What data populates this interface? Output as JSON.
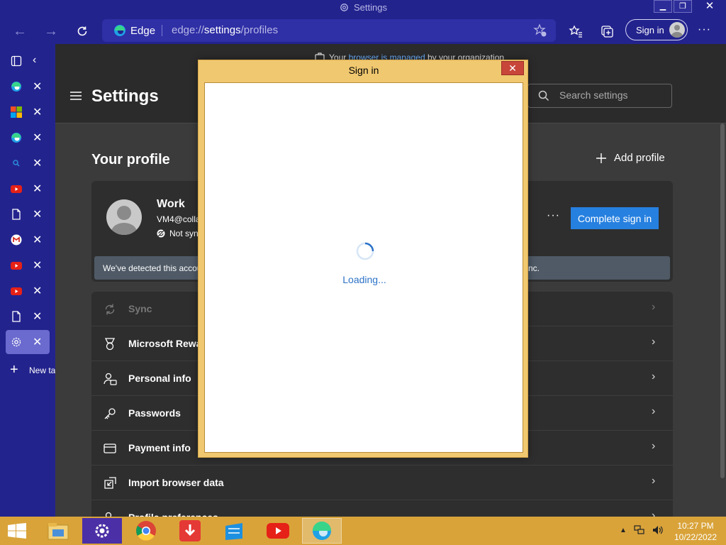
{
  "window": {
    "title": "Settings",
    "minimize": "▁",
    "restore": "❐",
    "close": "✕"
  },
  "toolbar": {
    "back_icon": "←",
    "forward_icon": "→",
    "brand": "Edge",
    "url_prefix": "edge://",
    "url_highlight": "settings",
    "url_suffix": "/profiles",
    "signin_label": "Sign in",
    "more": "···"
  },
  "vertical_tabs": {
    "close_glyph": "✕",
    "items": [
      {
        "icon": "edge-icon"
      },
      {
        "icon": "windows-icon"
      },
      {
        "icon": "edge-icon"
      },
      {
        "icon": "search-icon"
      },
      {
        "icon": "youtube-icon"
      },
      {
        "icon": "document-icon"
      },
      {
        "icon": "gmail-icon"
      },
      {
        "icon": "youtube-icon"
      },
      {
        "icon": "youtube-icon"
      },
      {
        "icon": "document-icon"
      },
      {
        "icon": "gear-icon",
        "active": true
      }
    ],
    "new_tab_label": "New tab"
  },
  "managed_bar": {
    "pre": "Your ",
    "link": "browser is managed",
    "post": " by your organization"
  },
  "settings": {
    "title": "Settings",
    "search_placeholder": "Search settings",
    "your_profile": "Your profile",
    "add_profile": "Add profile"
  },
  "profile": {
    "name": "Work",
    "email": "VM4@colla",
    "sync_status": "Not syn",
    "more": "···",
    "complete_sign_in": "Complete sign in",
    "detected_left": "We've detected this accou",
    "detected_right": "ync."
  },
  "menu_items": [
    {
      "label": "Sync",
      "icon": "sync-icon",
      "disabled": true
    },
    {
      "label": "Microsoft Rewa",
      "icon": "rewards-icon"
    },
    {
      "label": "Personal info",
      "icon": "personal-info-icon"
    },
    {
      "label": "Passwords",
      "icon": "key-icon"
    },
    {
      "label": "Payment info",
      "icon": "credit-card-icon"
    },
    {
      "label": "Import browser data",
      "icon": "import-icon"
    },
    {
      "label": "Profile preferences",
      "icon": "profile-prefs-icon"
    }
  ],
  "chevron": "›",
  "dialog": {
    "title": "Sign in",
    "close": "✕",
    "loading": "Loading..."
  },
  "taskbar": {
    "apps": [
      "file-explorer-icon",
      "settings-app-icon",
      "chrome-icon",
      "download-icon",
      "store-icon",
      "youtube-icon",
      "edge-icon"
    ],
    "time": "10:27 PM",
    "date": "10/22/2022"
  }
}
